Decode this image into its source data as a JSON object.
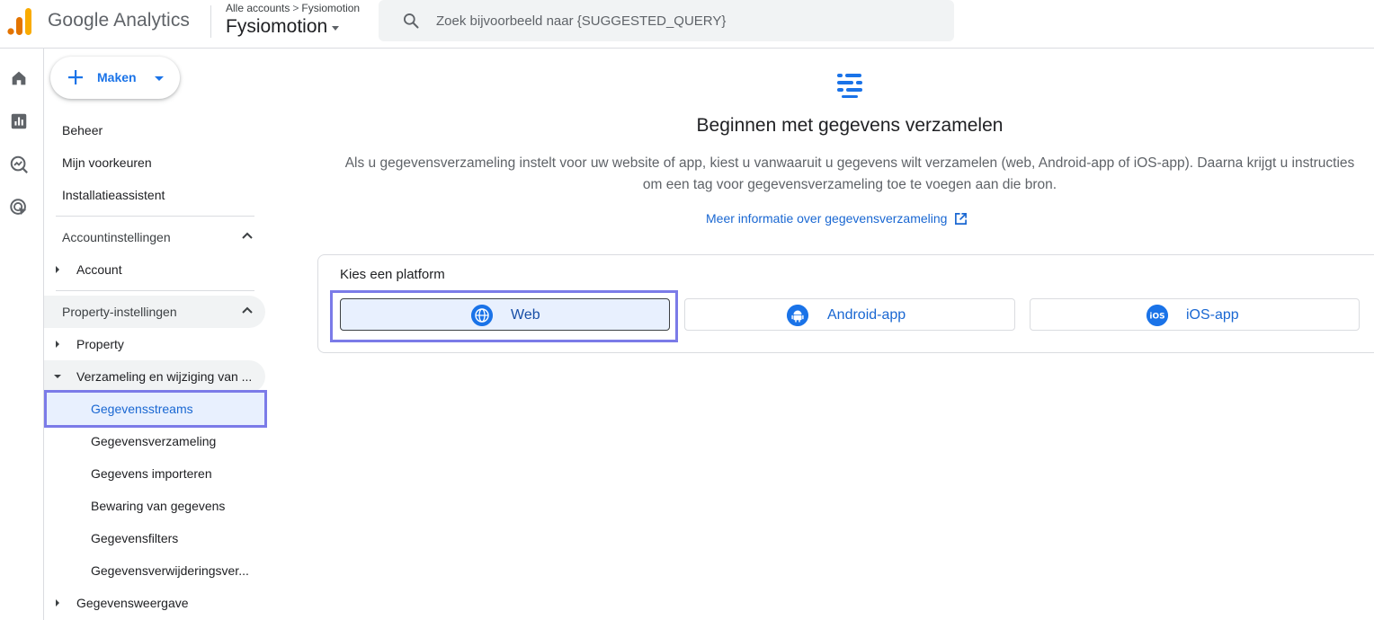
{
  "header": {
    "product_name": "Google Analytics",
    "breadcrumb_root": "Alle accounts",
    "breadcrumb_sep": ">",
    "breadcrumb_account": "Fysiomotion",
    "property_name": "Fysiomotion",
    "search_placeholder": "Zoek bijvoorbeeld naar {SUGGESTED_QUERY}"
  },
  "rail": {
    "items": [
      {
        "icon": "home-icon"
      },
      {
        "icon": "reports-icon"
      },
      {
        "icon": "explore-icon"
      },
      {
        "icon": "advertising-icon"
      }
    ]
  },
  "subnav": {
    "create_label": "Maken",
    "top_items": [
      "Beheer",
      "Mijn voorkeuren",
      "Installatieassistent"
    ],
    "account_section": "Accountinstellingen",
    "account_item": "Account",
    "property_section": "Property-instellingen",
    "property_item": "Property",
    "collection_group": "Verzameling en wijziging van ...",
    "collection_items": [
      "Gegevensstreams",
      "Gegevensverzameling",
      "Gegevens importeren",
      "Bewaring van gegevens",
      "Gegevensfilters",
      "Gegevensverwijderingsver..."
    ],
    "data_display": "Gegevensweergave"
  },
  "main": {
    "title": "Beginnen met gegevens verzamelen",
    "description": "Als u gegevensverzameling instelt voor uw website of app, kiest u vanwaaruit u gegevens wilt verzamelen (web, Android-app of iOS-app). Daarna krijgt u instructies om een tag voor gegevensverzameling toe te voegen aan die bron.",
    "more_info": "Meer informatie over gegevensverzameling",
    "platform_label": "Kies een platform",
    "platforms": [
      {
        "label": "Web",
        "icon": "globe-icon",
        "selected": true
      },
      {
        "label": "Android-app",
        "icon": "android-icon",
        "selected": false
      },
      {
        "label": "iOS-app",
        "icon": "ios-icon",
        "selected": false
      }
    ]
  },
  "colors": {
    "accent": "#1a73e8",
    "link": "#1967d2",
    "highlight": "#7b7be8",
    "selected_bg": "#e8f0fe"
  }
}
